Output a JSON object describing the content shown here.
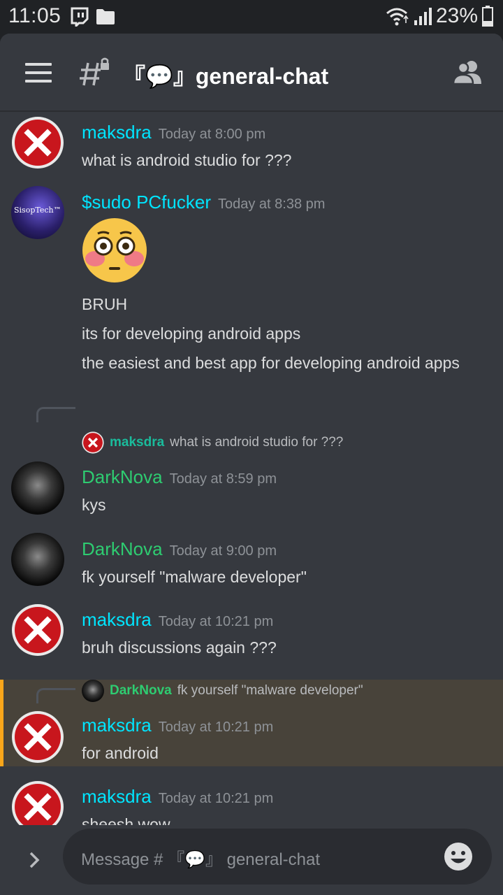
{
  "status_bar": {
    "time": "11:05",
    "battery": "23%"
  },
  "header": {
    "channel_title": "『💬』general-chat"
  },
  "messages": [
    {
      "author": "maksdra",
      "author_color": "#00e5ff",
      "timestamp": "Today at 8:00 pm",
      "lines": [
        "what is android studio for ???"
      ]
    },
    {
      "author": "$sudo PCfucker",
      "author_color": "#00e5ff",
      "avatar_text": "SisopTech™",
      "timestamp": "Today at 8:38 pm",
      "emoji": "😳",
      "lines": [
        "BRUH",
        "its for developing android apps",
        "the easiest and best app for developing android apps"
      ]
    },
    {
      "reply": {
        "author": "maksdra",
        "text": "what is android studio for ???"
      },
      "author": "DarkNova",
      "author_color": "#2ecc71",
      "timestamp": "Today at 8:59 pm",
      "lines": [
        "kys"
      ]
    },
    {
      "author": "DarkNova",
      "author_color": "#2ecc71",
      "timestamp": "Today at 9:00 pm",
      "lines": [
        "fk yourself \"malware developer\""
      ]
    },
    {
      "author": "maksdra",
      "author_color": "#00e5ff",
      "timestamp": "Today at 10:21 pm",
      "lines": [
        "bruh discussions again ???"
      ]
    },
    {
      "reply": {
        "author": "DarkNova",
        "text": "fk yourself \"malware developer\""
      },
      "author": "maksdra",
      "author_color": "#00e5ff",
      "timestamp": "Today at 10:21 pm",
      "lines": [
        "for android"
      ],
      "highlighted": true
    },
    {
      "author": "maksdra",
      "author_color": "#00e5ff",
      "timestamp": "Today at 10:21 pm",
      "lines": [
        "sheesh wow"
      ]
    }
  ],
  "composer": {
    "placeholder": "Message # 『💬』 general-chat"
  },
  "colors": {
    "background": "#36393f",
    "status_bar": "#202225",
    "timestamp": "#8e9297",
    "mention_highlight": "#faa61a",
    "reply_author": "#1abc9c"
  }
}
